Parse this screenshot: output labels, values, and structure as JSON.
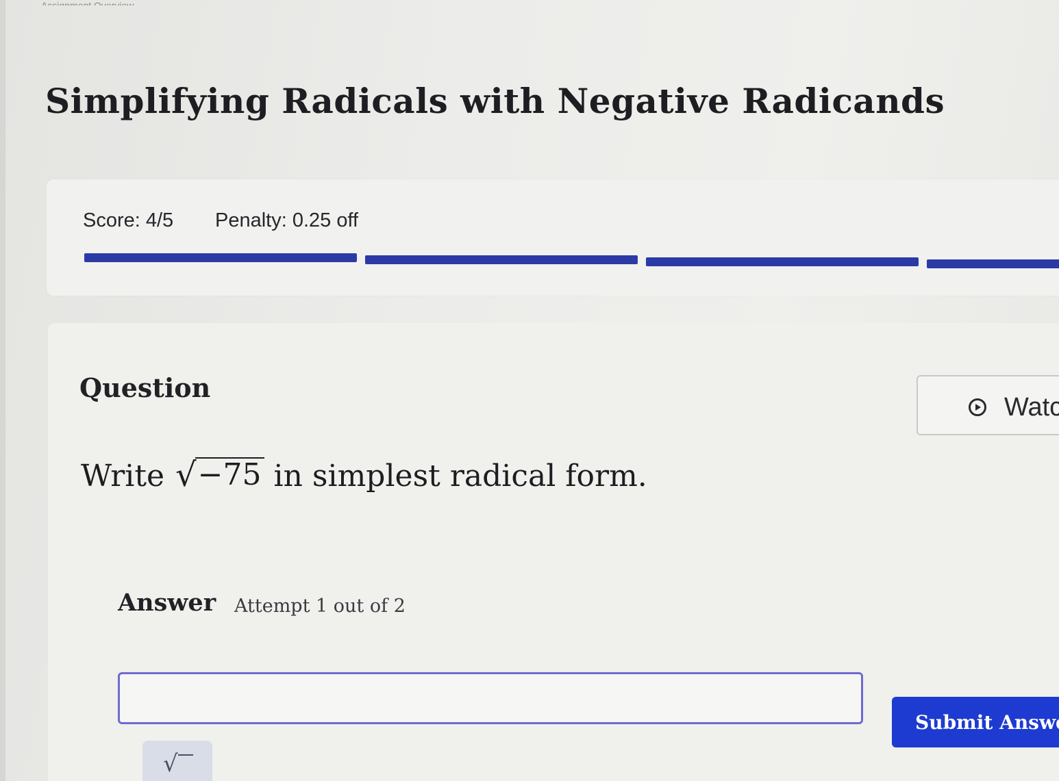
{
  "colors": {
    "accent": "#1e3bd1",
    "progress": "#2c3aa6",
    "input_border": "#6f6ad1",
    "background": "#ececea"
  },
  "header": {
    "top_strip_text": "Assignment Overview"
  },
  "page": {
    "title": "Simplifying Radicals with Negative Radicands"
  },
  "score_panel": {
    "score": "Score: 4/5",
    "penalty": "Penalty: 0.25 off",
    "progress_segments": 5,
    "progress_completed": 4
  },
  "question": {
    "heading": "Question",
    "watch_button": {
      "label": "Watc",
      "icon": "play-circle-icon"
    },
    "prompt_before": "Write",
    "radical_symbol": "√",
    "radicand": "−75",
    "prompt_after": "in simplest radical form."
  },
  "answer": {
    "label": "Answer",
    "attempt": "Attempt 1 out of 2",
    "input_value": "",
    "input_placeholder": "",
    "submit_label": "Submit Answer",
    "tool_icon": "square-root-icon",
    "tool_glyph": "√"
  }
}
